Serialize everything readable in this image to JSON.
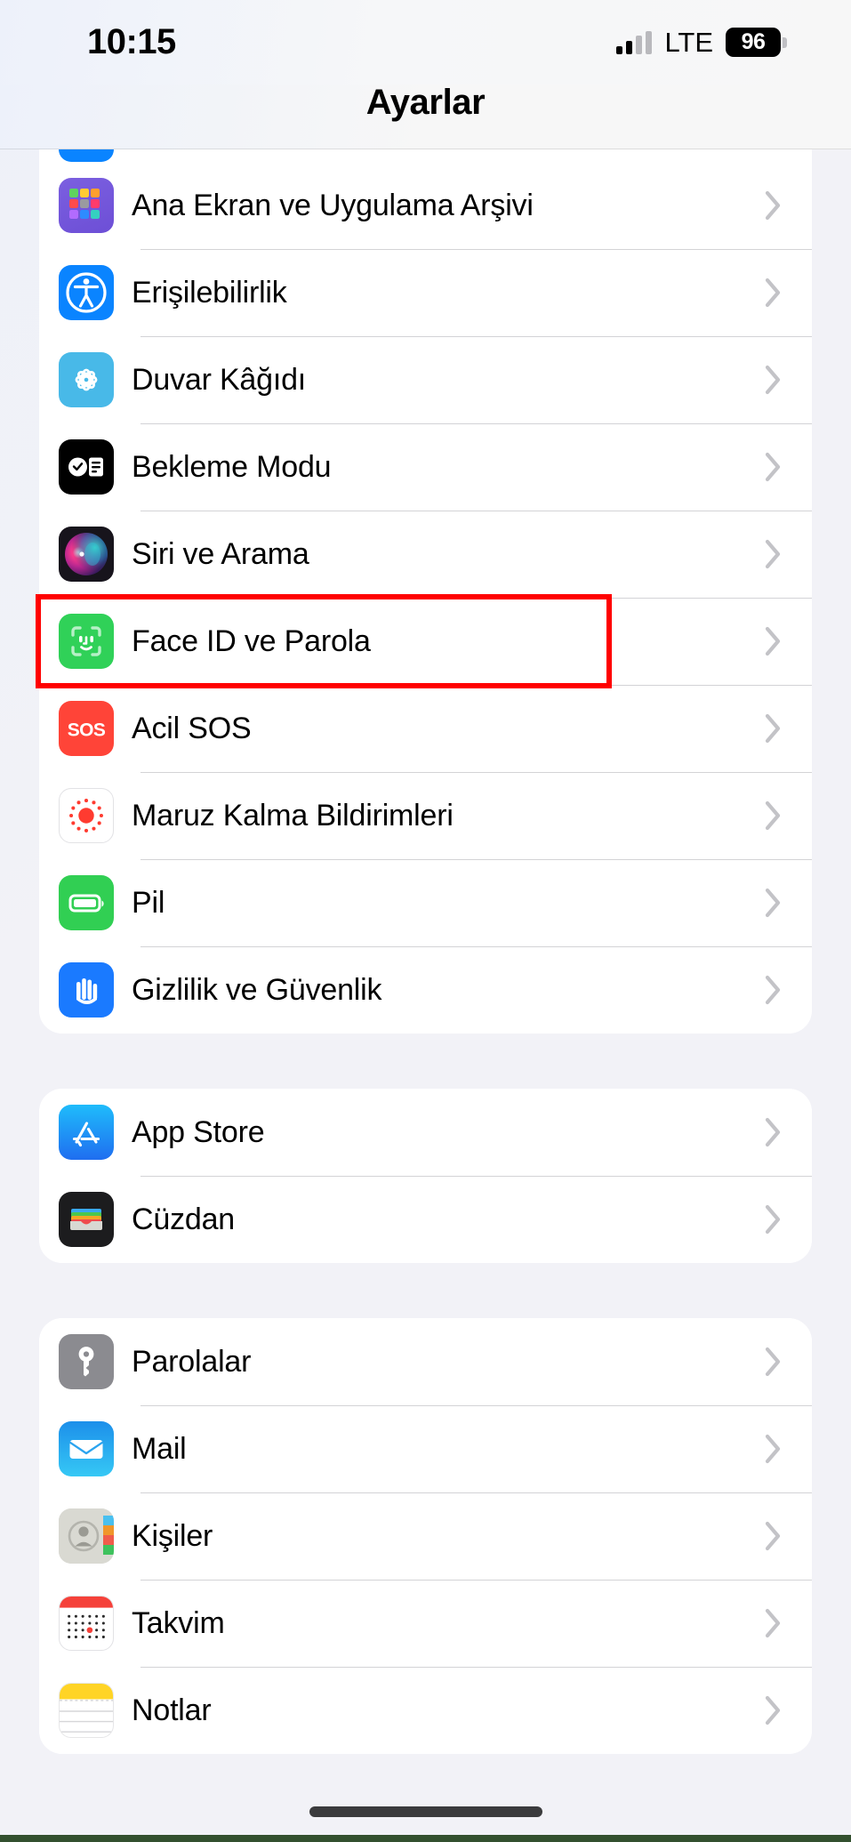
{
  "status_bar": {
    "time": "10:15",
    "network_label": "LTE",
    "battery_level": "96",
    "signal_icon": "cellular-signal-icon",
    "battery_icon": "battery-icon"
  },
  "nav": {
    "title": "Ayarlar"
  },
  "colors": {
    "highlight": "#ff0000",
    "page_background": "#f2f2f7",
    "row_background": "#ffffff",
    "separator": "#d3d3d6",
    "chevron": "#c3c3c7"
  },
  "highlight": {
    "target_row": "Face ID ve Parola"
  },
  "groups": [
    {
      "id": "system-group",
      "clipped_top": true,
      "rows": [
        {
          "label": "Ana Ekran ve Uygulama Arşivi",
          "icon": "home-screen-icon"
        },
        {
          "label": "Erişilebilirlik",
          "icon": "accessibility-icon"
        },
        {
          "label": "Duvar Kâğıdı",
          "icon": "wallpaper-icon"
        },
        {
          "label": "Bekleme Modu",
          "icon": "standby-icon"
        },
        {
          "label": "Siri ve Arama",
          "icon": "siri-icon"
        },
        {
          "label": "Face ID ve Parola",
          "icon": "face-id-icon"
        },
        {
          "label": "Acil SOS",
          "icon": "emergency-sos-icon"
        },
        {
          "label": "Maruz Kalma Bildirimleri",
          "icon": "exposure-notifications-icon"
        },
        {
          "label": "Pil",
          "icon": "battery-settings-icon"
        },
        {
          "label": "Gizlilik ve Güvenlik",
          "icon": "privacy-icon"
        }
      ]
    },
    {
      "id": "store-group",
      "clipped_top": false,
      "rows": [
        {
          "label": "App Store",
          "icon": "app-store-icon"
        },
        {
          "label": "Cüzdan",
          "icon": "wallet-icon"
        }
      ]
    },
    {
      "id": "apps-group",
      "clipped_top": false,
      "rows": [
        {
          "label": "Parolalar",
          "icon": "passwords-icon"
        },
        {
          "label": "Mail",
          "icon": "mail-icon"
        },
        {
          "label": "Kişiler",
          "icon": "contacts-icon"
        },
        {
          "label": "Takvim",
          "icon": "calendar-icon"
        },
        {
          "label": "Notlar",
          "icon": "notes-icon"
        }
      ]
    }
  ]
}
